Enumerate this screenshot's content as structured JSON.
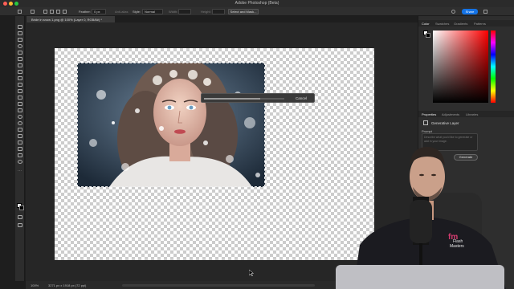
{
  "window": {
    "title": "Adobe Photoshop (Beta)"
  },
  "options_bar": {
    "feather_label": "Feather:",
    "feather_value": "0 px",
    "antialias_label": "Anti-alias",
    "style_label": "Style:",
    "style_value": "Normal",
    "width_label": "Width:",
    "height_label": "Height:",
    "select_mask_label": "Select and Mask...",
    "share_label": "Share"
  },
  "document": {
    "tab_label": "Bride in snow 1.png @ 100% (Layer 0, RGB/8#) *",
    "progress_fraction": 0.7,
    "cancel_label": "Cancel"
  },
  "status_bar": {
    "zoom": "100%",
    "doc_info": "3271 px x 1918 px (72 ppi)"
  },
  "panels": {
    "top_tabs": [
      "Color",
      "Swatches",
      "Gradients",
      "Patterns"
    ],
    "mid_tabs": [
      "Properties",
      "Adjustments",
      "Libraries"
    ],
    "generative_title": "Generative Layer",
    "prompt_label": "Prompt",
    "prompt_placeholder": "Describe what you'd like to generate or add in your image.",
    "generate_label": "Generate"
  },
  "presenter_shirt_text": [
    "Flash",
    "Masters"
  ],
  "colors": {
    "accent": "#1473e6",
    "close": "#ff5f57",
    "minimize": "#febc2e",
    "maximize": "#28c840"
  }
}
